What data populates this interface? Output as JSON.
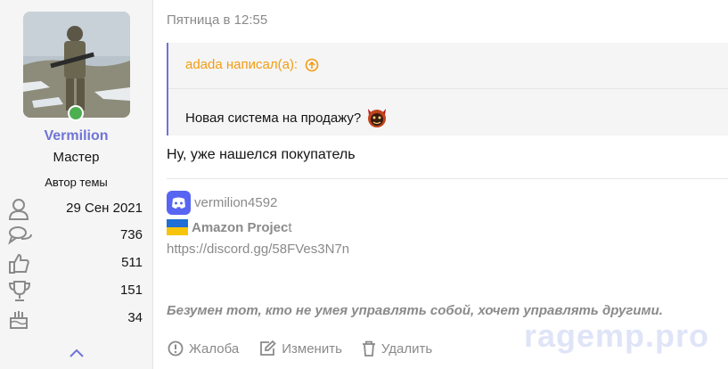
{
  "user": {
    "name": "Vermilion",
    "rank": "Мастер",
    "badge": "Автор темы",
    "stats": [
      {
        "icon": "user-icon",
        "value": "29 Сен 2021"
      },
      {
        "icon": "messages-icon",
        "value": "736"
      },
      {
        "icon": "thumbs-up-icon",
        "value": "511"
      },
      {
        "icon": "trophy-icon",
        "value": "151"
      },
      {
        "icon": "birthday-cake-icon",
        "value": "34"
      }
    ]
  },
  "post": {
    "date": "Пятница в 12:55",
    "quote": {
      "author": "adada написал(а):",
      "text": "Новая система на продажу?"
    },
    "message": "Ну, уже нашелся покупатель",
    "signature": {
      "discord": "vermilion4592",
      "project_bold": "Amazon Projec",
      "project_rest": "t",
      "link": "https://discord.gg/58FVes3N7n",
      "quote": "Безумен тот, кто не умея управлять собой, хочет управлять другими."
    },
    "actions": {
      "report": "Жалоба",
      "edit": "Изменить",
      "delete": "Удалить"
    }
  },
  "watermark": "ragemp.pro",
  "colors": {
    "accent": "#6f74d6",
    "quote_author": "#f39c12",
    "discord": "#5865f2",
    "online": "#4caf50"
  }
}
